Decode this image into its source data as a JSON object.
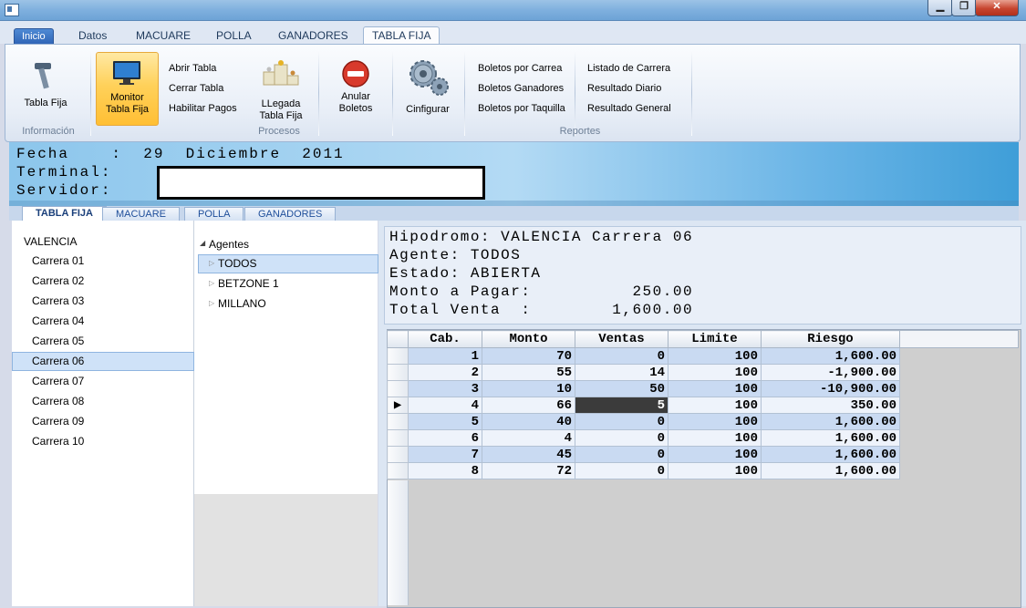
{
  "window": {
    "min_label": "▁",
    "max_label": "❐",
    "close_label": "✕"
  },
  "ribbon_tabs": [
    "Inicio",
    "Datos",
    "MACUARE",
    "POLLA",
    "GANADORES",
    "TABLA FIJA"
  ],
  "ribbon": {
    "tabla_fija": "Tabla Fija",
    "monitor_line1": "Monitor",
    "monitor_line2": "Tabla Fija",
    "abrir_tabla": "Abrir Tabla",
    "cerrar_tabla": "Cerrar Tabla",
    "habilitar_pagos": "Habilitar Pagos",
    "llegada_line1": "LLegada",
    "llegada_line2": "Tabla Fija",
    "anular_line1": "Anular",
    "anular_line2": "Boletos",
    "configurar": "Cinfigurar",
    "boletos_carrera": "Boletos por Carrea",
    "boletos_ganadores": "Boletos Ganadores",
    "boletos_taquilla": "Boletos por Taquilla",
    "listado_carrera": "Listado de Carrera",
    "resultado_diario": "Resultado Diario",
    "resultado_general": "Resultado General",
    "group_informacion": "Información",
    "group_procesos": "Procesos",
    "group_reportes": "Reportes"
  },
  "banner": {
    "fecha_line": "Fecha    :  29  Diciembre  2011",
    "terminal_label": "Terminal:",
    "servidor_label": "Servidor:"
  },
  "lower_tabs": [
    "TABLA FIJA",
    "MACUARE",
    "POLLA",
    "GANADORES"
  ],
  "carreras": {
    "hipodromo": "VALENCIA",
    "items": [
      "Carrera 01",
      "Carrera 02",
      "Carrera 03",
      "Carrera 04",
      "Carrera 05",
      "Carrera 06",
      "Carrera 07",
      "Carrera 08",
      "Carrera 09",
      "Carrera 10"
    ],
    "selected": "Carrera 06"
  },
  "agentes": {
    "root": "Agentes",
    "items": [
      "TODOS",
      "BETZONE 1",
      "MILLANO"
    ],
    "selected": "TODOS"
  },
  "info": {
    "hipodromo_line": "Hipodromo: VALENCIA Carrera 06",
    "agente_line": "Agente: TODOS",
    "estado_line": "Estado: ABIERTA",
    "monto_line": "Monto a Pagar:          250.00",
    "total_line": "Total Venta  :        1,600.00"
  },
  "grid": {
    "columns": [
      "Cab.",
      "Monto",
      "Ventas",
      "Limite",
      "Riesgo"
    ],
    "rows": [
      [
        "1",
        "70",
        "0",
        "100",
        "1,600.00"
      ],
      [
        "2",
        "55",
        "14",
        "100",
        "-1,900.00"
      ],
      [
        "3",
        "10",
        "50",
        "100",
        "-10,900.00"
      ],
      [
        "4",
        "66",
        "5",
        "100",
        "350.00"
      ],
      [
        "5",
        "40",
        "0",
        "100",
        "1,600.00"
      ],
      [
        "6",
        "4",
        "0",
        "100",
        "1,600.00"
      ],
      [
        "7",
        "45",
        "0",
        "100",
        "1,600.00"
      ],
      [
        "8",
        "72",
        "0",
        "100",
        "1,600.00"
      ]
    ],
    "current_row_marker": "▶"
  }
}
